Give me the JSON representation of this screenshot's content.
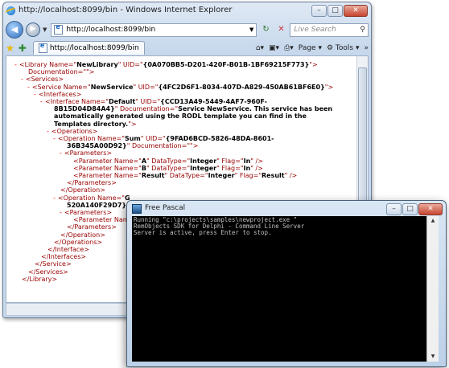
{
  "ie": {
    "title": "http://localhost:8099/bin - Windows Internet Explorer",
    "address": "http://localhost:8099/bin",
    "search_placeholder": "Live Search",
    "tab_label": "http://localhost:8099/bin",
    "tools": {
      "page": "Page",
      "tools": "Tools"
    },
    "xml": [
      {
        "i": 0,
        "m": "-",
        "p": [
          [
            "t",
            "<Library "
          ],
          [
            "a",
            "Name=\""
          ],
          [
            "v",
            "NewLibrary"
          ],
          [
            "a",
            "\" UID=\""
          ],
          [
            "v",
            "{0A070BB5-D201-420F-B01B-1BF69215F773}"
          ],
          [
            "a",
            "\">"
          ]
        ]
      },
      {
        "i": 1,
        "p": [
          [
            "t",
            "Documentation=\""
          ],
          [
            "v",
            ""
          ],
          [
            "t",
            "\">"
          ]
        ]
      },
      {
        "i": 1,
        "m": "-",
        "p": [
          [
            "t",
            "<Services>"
          ]
        ]
      },
      {
        "i": 2,
        "m": "-",
        "p": [
          [
            "t",
            "<Service "
          ],
          [
            "a",
            "Name=\""
          ],
          [
            "v",
            "NewService"
          ],
          [
            "a",
            "\" UID=\""
          ],
          [
            "v",
            "{4FC2D6F1-8034-407D-A829-450AB61BF6E0}"
          ],
          [
            "a",
            "\">"
          ]
        ]
      },
      {
        "i": 3,
        "m": "-",
        "p": [
          [
            "t",
            "<Interfaces>"
          ]
        ]
      },
      {
        "i": 4,
        "m": "-",
        "p": [
          [
            "t",
            "<Interface "
          ],
          [
            "a",
            "Name=\""
          ],
          [
            "v",
            "Default"
          ],
          [
            "a",
            "\" UID=\""
          ],
          [
            "v",
            "{CCD13A49-5449-4AF7-960F-"
          ]
        ]
      },
      {
        "i": 5,
        "p": [
          [
            "v",
            "8B15D04D84A4}"
          ],
          [
            "a",
            "\" Documentation=\""
          ],
          [
            "v",
            "Service NewService. This service has been"
          ]
        ]
      },
      {
        "i": 5,
        "p": [
          [
            "v",
            "automatically generated using the RODL template you can find in the"
          ]
        ]
      },
      {
        "i": 5,
        "p": [
          [
            "v",
            "Templates directory."
          ],
          [
            "a",
            "\">"
          ]
        ]
      },
      {
        "i": 5,
        "m": "-",
        "p": [
          [
            "t",
            "<Operations>"
          ]
        ]
      },
      {
        "i": 6,
        "m": "-",
        "p": [
          [
            "t",
            "<Operation "
          ],
          [
            "a",
            "Name=\""
          ],
          [
            "v",
            "Sum"
          ],
          [
            "a",
            "\" UID=\""
          ],
          [
            "v",
            "{9FAD6BCD-5826-48DA-8601-"
          ]
        ]
      },
      {
        "i": 7,
        "p": [
          [
            "v",
            "36B345A00D92}"
          ],
          [
            "a",
            "\" Documentation=\""
          ],
          [
            "v",
            ""
          ],
          [
            "a",
            "\">"
          ]
        ]
      },
      {
        "i": 7,
        "m": "-",
        "p": [
          [
            "t",
            "<Parameters>"
          ]
        ]
      },
      {
        "i": 8,
        "p": [
          [
            "t",
            "<Parameter "
          ],
          [
            "a",
            "Name=\""
          ],
          [
            "v",
            "A"
          ],
          [
            "a",
            "\" DataType=\""
          ],
          [
            "v",
            "Integer"
          ],
          [
            "a",
            "\" Flag=\""
          ],
          [
            "v",
            "In"
          ],
          [
            "a",
            "\" />"
          ]
        ]
      },
      {
        "i": 8,
        "p": [
          [
            "t",
            "<Parameter "
          ],
          [
            "a",
            "Name=\""
          ],
          [
            "v",
            "B"
          ],
          [
            "a",
            "\" DataType=\""
          ],
          [
            "v",
            "Integer"
          ],
          [
            "a",
            "\" Flag=\""
          ],
          [
            "v",
            "In"
          ],
          [
            "a",
            "\" />"
          ]
        ]
      },
      {
        "i": 8,
        "p": [
          [
            "t",
            "<Parameter "
          ],
          [
            "a",
            "Name=\""
          ],
          [
            "v",
            "Result"
          ],
          [
            "a",
            "\" DataType=\""
          ],
          [
            "v",
            "Integer"
          ],
          [
            "a",
            "\" Flag=\""
          ],
          [
            "v",
            "Result"
          ],
          [
            "a",
            "\" />"
          ]
        ]
      },
      {
        "i": 7,
        "p": [
          [
            "t",
            "</Parameters>"
          ]
        ]
      },
      {
        "i": 6,
        "p": [
          [
            "t",
            "</Operation>"
          ]
        ]
      },
      {
        "i": 6,
        "m": "-",
        "p": [
          [
            "t",
            "<Operation "
          ],
          [
            "a",
            "Name=\""
          ],
          [
            "v",
            "G"
          ]
        ]
      },
      {
        "i": 7,
        "p": [
          [
            "v",
            "520A140F29D7}"
          ]
        ]
      },
      {
        "i": 7,
        "m": "-",
        "p": [
          [
            "t",
            "<Parameters>"
          ]
        ]
      },
      {
        "i": 8,
        "p": [
          [
            "t",
            "<Parameter "
          ],
          [
            "a",
            "Nam"
          ]
        ]
      },
      {
        "i": 7,
        "p": [
          [
            "t",
            "</Parameters>"
          ]
        ]
      },
      {
        "i": 6,
        "p": [
          [
            "t",
            "</Operation>"
          ]
        ]
      },
      {
        "i": 5,
        "p": [
          [
            "t",
            "</Operations>"
          ]
        ]
      },
      {
        "i": 4,
        "p": [
          [
            "t",
            "</Interface>"
          ]
        ]
      },
      {
        "i": 3,
        "p": [
          [
            "t",
            "</Interfaces>"
          ]
        ]
      },
      {
        "i": 2,
        "p": [
          [
            "t",
            "</Service>"
          ]
        ]
      },
      {
        "i": 1,
        "p": [
          [
            "t",
            "</Services>"
          ]
        ]
      },
      {
        "i": 0,
        "p": [
          [
            "t",
            "</Library>"
          ]
        ]
      }
    ]
  },
  "console": {
    "title": "Free Pascal",
    "lines": [
      "Running \"c:\\projects\\samples\\newproject.exe \"",
      "RemObjects SDK for Delphi - Command Line Server",
      "Server is active, press Enter to stop."
    ]
  },
  "icons": [
    "ie-logo-icon",
    "back-icon",
    "forward-icon",
    "refresh-icon",
    "stop-icon",
    "search-icon",
    "favorites-star-icon",
    "add-favorites-icon",
    "home-icon",
    "feeds-icon",
    "print-icon",
    "page-icon",
    "tools-gear-icon",
    "free-pascal-icon"
  ]
}
